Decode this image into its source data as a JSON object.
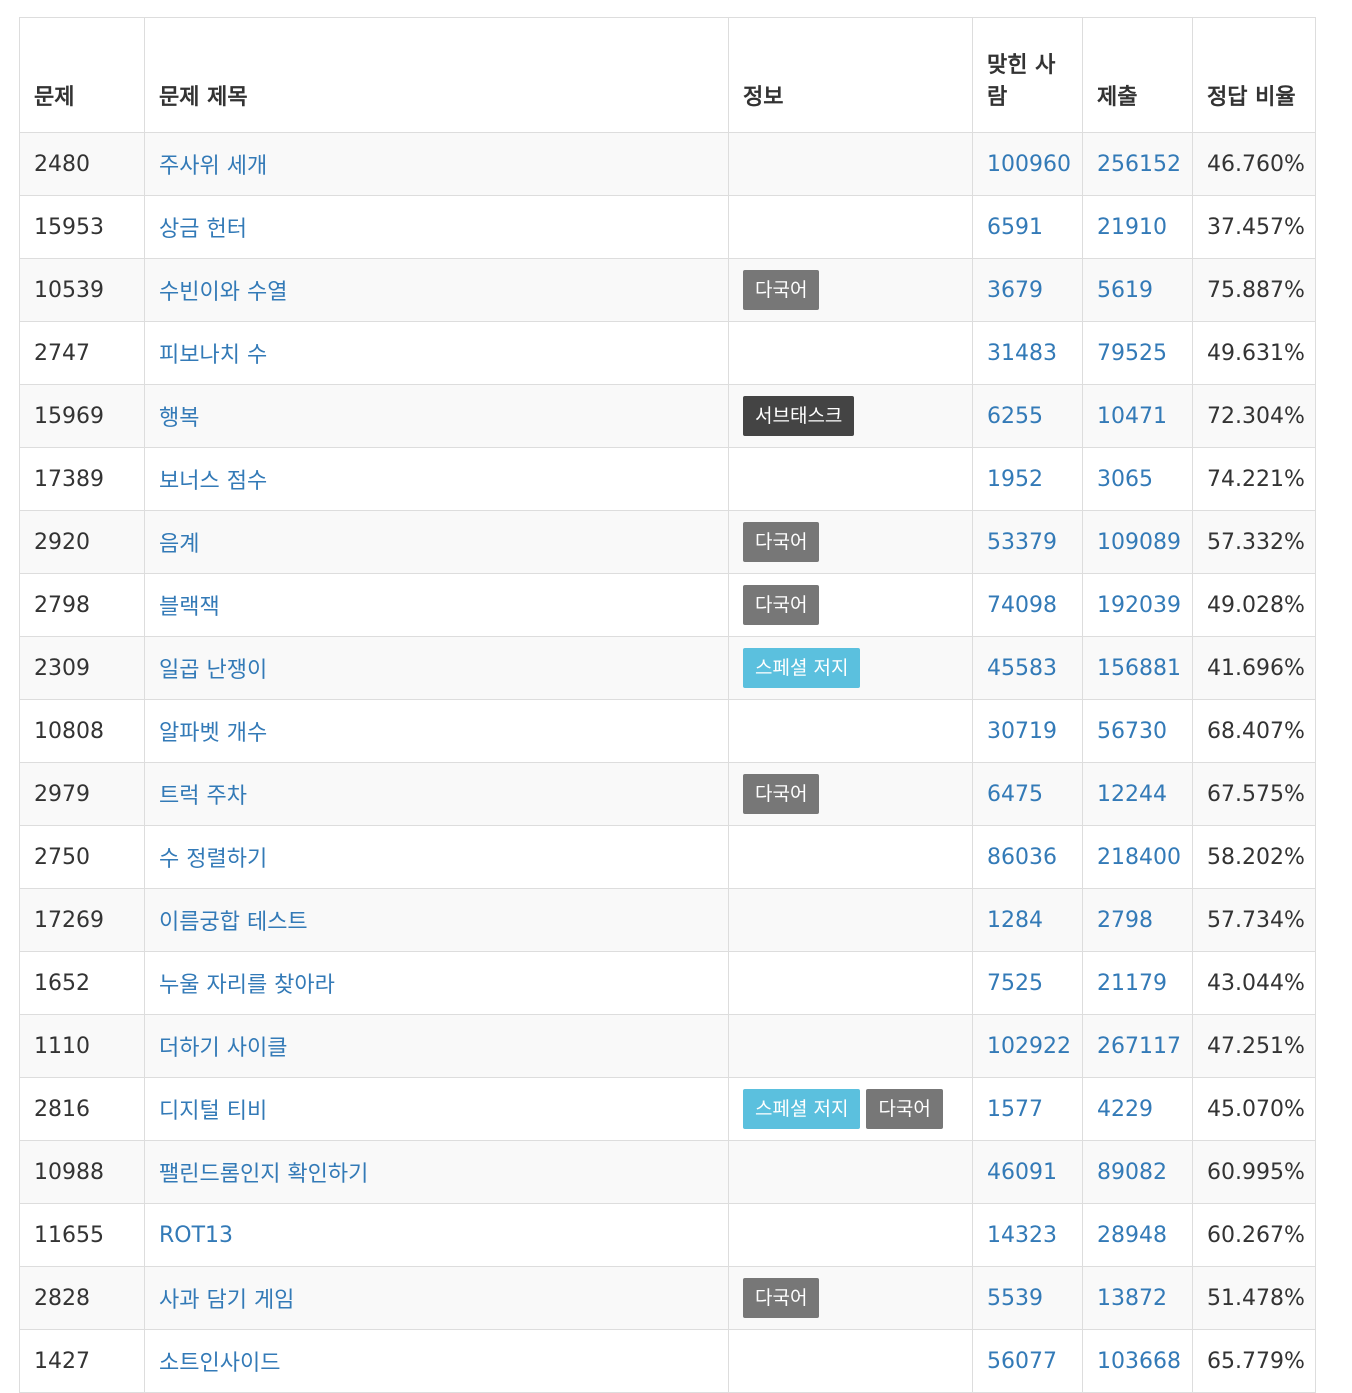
{
  "header": {
    "problem_id": "문제",
    "title": "문제 제목",
    "info": "정보",
    "solved": "맞힌 사람",
    "submissions": "제출",
    "ratio": "정답 비율"
  },
  "rows": [
    {
      "id": "2480",
      "title": "주사위 세개",
      "tags": [],
      "solved": "100960",
      "submissions": "256152",
      "ratio": "46.760%"
    },
    {
      "id": "15953",
      "title": "상금 헌터",
      "tags": [],
      "solved": "6591",
      "submissions": "21910",
      "ratio": "37.457%"
    },
    {
      "id": "10539",
      "title": "수빈이와 수열",
      "tags": [
        {
          "text": "다국어",
          "type": "multi"
        }
      ],
      "solved": "3679",
      "submissions": "5619",
      "ratio": "75.887%"
    },
    {
      "id": "2747",
      "title": "피보나치 수",
      "tags": [],
      "solved": "31483",
      "submissions": "79525",
      "ratio": "49.631%"
    },
    {
      "id": "15969",
      "title": "행복",
      "tags": [
        {
          "text": "서브태스크",
          "type": "subtask"
        }
      ],
      "solved": "6255",
      "submissions": "10471",
      "ratio": "72.304%"
    },
    {
      "id": "17389",
      "title": "보너스 점수",
      "tags": [],
      "solved": "1952",
      "submissions": "3065",
      "ratio": "74.221%"
    },
    {
      "id": "2920",
      "title": "음계",
      "tags": [
        {
          "text": "다국어",
          "type": "multi"
        }
      ],
      "solved": "53379",
      "submissions": "109089",
      "ratio": "57.332%"
    },
    {
      "id": "2798",
      "title": "블랙잭",
      "tags": [
        {
          "text": "다국어",
          "type": "multi"
        }
      ],
      "solved": "74098",
      "submissions": "192039",
      "ratio": "49.028%"
    },
    {
      "id": "2309",
      "title": "일곱 난쟁이",
      "tags": [
        {
          "text": "스페셜 저지",
          "type": "special"
        }
      ],
      "solved": "45583",
      "submissions": "156881",
      "ratio": "41.696%"
    },
    {
      "id": "10808",
      "title": "알파벳 개수",
      "tags": [],
      "solved": "30719",
      "submissions": "56730",
      "ratio": "68.407%"
    },
    {
      "id": "2979",
      "title": "트럭 주차",
      "tags": [
        {
          "text": "다국어",
          "type": "multi"
        }
      ],
      "solved": "6475",
      "submissions": "12244",
      "ratio": "67.575%"
    },
    {
      "id": "2750",
      "title": "수 정렬하기",
      "tags": [],
      "solved": "86036",
      "submissions": "218400",
      "ratio": "58.202%"
    },
    {
      "id": "17269",
      "title": "이름궁합 테스트",
      "tags": [],
      "solved": "1284",
      "submissions": "2798",
      "ratio": "57.734%"
    },
    {
      "id": "1652",
      "title": "누울 자리를 찾아라",
      "tags": [],
      "solved": "7525",
      "submissions": "21179",
      "ratio": "43.044%"
    },
    {
      "id": "1110",
      "title": "더하기 사이클",
      "tags": [],
      "solved": "102922",
      "submissions": "267117",
      "ratio": "47.251%"
    },
    {
      "id": "2816",
      "title": "디지털 티비",
      "tags": [
        {
          "text": "스페셜 저지",
          "type": "special"
        },
        {
          "text": "다국어",
          "type": "multi"
        }
      ],
      "solved": "1577",
      "submissions": "4229",
      "ratio": "45.070%"
    },
    {
      "id": "10988",
      "title": "팰린드롬인지 확인하기",
      "tags": [],
      "solved": "46091",
      "submissions": "89082",
      "ratio": "60.995%"
    },
    {
      "id": "11655",
      "title": "ROT13",
      "tags": [],
      "solved": "14323",
      "submissions": "28948",
      "ratio": "60.267%"
    },
    {
      "id": "2828",
      "title": "사과 담기 게임",
      "tags": [
        {
          "text": "다국어",
          "type": "multi"
        }
      ],
      "solved": "5539",
      "submissions": "13872",
      "ratio": "51.478%"
    },
    {
      "id": "1427",
      "title": "소트인사이드",
      "tags": [],
      "solved": "56077",
      "submissions": "103668",
      "ratio": "65.779%"
    }
  ],
  "colors": {
    "link": "#337ab7",
    "label_multi": "#777777",
    "label_subtask": "#444444",
    "label_special": "#5bc0de",
    "stripe": "#f9f9f9",
    "border": "#dddddd"
  }
}
